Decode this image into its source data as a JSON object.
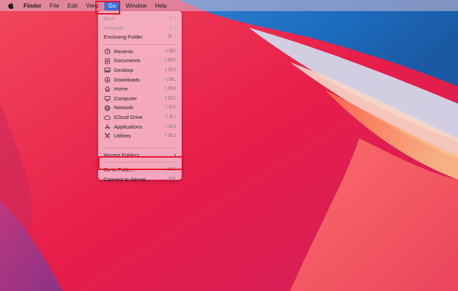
{
  "menubar": {
    "apple_icon": "apple-logo-icon",
    "items": [
      {
        "label": "Finder"
      },
      {
        "label": "File"
      },
      {
        "label": "Edit"
      },
      {
        "label": "View"
      },
      {
        "label": "Go"
      },
      {
        "label": "Window"
      },
      {
        "label": "Help"
      }
    ]
  },
  "go_menu": {
    "nav": [
      {
        "label": "Back",
        "shortcut": "⌘ [",
        "disabled": true
      },
      {
        "label": "Forward",
        "shortcut": "⌘ ]",
        "disabled": true
      },
      {
        "label": "Enclosing Folder",
        "shortcut": "⌘ ↑",
        "disabled": false
      }
    ],
    "locations": [
      {
        "label": "Recents",
        "shortcut": "⇧⌘F",
        "icon": "clock-icon"
      },
      {
        "label": "Documents",
        "shortcut": "⇧⌘O",
        "icon": "document-icon"
      },
      {
        "label": "Desktop",
        "shortcut": "⇧⌘D",
        "icon": "desktop-icon"
      },
      {
        "label": "Downloads",
        "shortcut": "⌥⌘L",
        "icon": "download-icon"
      },
      {
        "label": "Home",
        "shortcut": "⇧⌘H",
        "icon": "home-icon"
      },
      {
        "label": "Computer",
        "shortcut": "⇧⌘C",
        "icon": "monitor-icon"
      },
      {
        "label": "Network",
        "shortcut": "⇧⌘K",
        "icon": "globe-icon"
      },
      {
        "label": "iCloud Drive",
        "shortcut": "⇧⌘ I",
        "icon": "cloud-icon"
      },
      {
        "label": "Applications",
        "shortcut": "⇧⌘A",
        "icon": "applications-icon"
      },
      {
        "label": "Utilities",
        "shortcut": "⇧⌘U",
        "icon": "tools-icon"
      }
    ],
    "recent_folders": {
      "label": "Recent Folders",
      "submenu_indicator": "›"
    },
    "go_to_folder": {
      "label": "Go to Folder...",
      "shortcut": "⇧⌘G"
    },
    "connect_to_server": {
      "label": "Connect to Server...",
      "shortcut": "⌘K"
    }
  },
  "colors": {
    "highlight_box": "#e8102a",
    "menu_active": "#3f6ed8"
  }
}
